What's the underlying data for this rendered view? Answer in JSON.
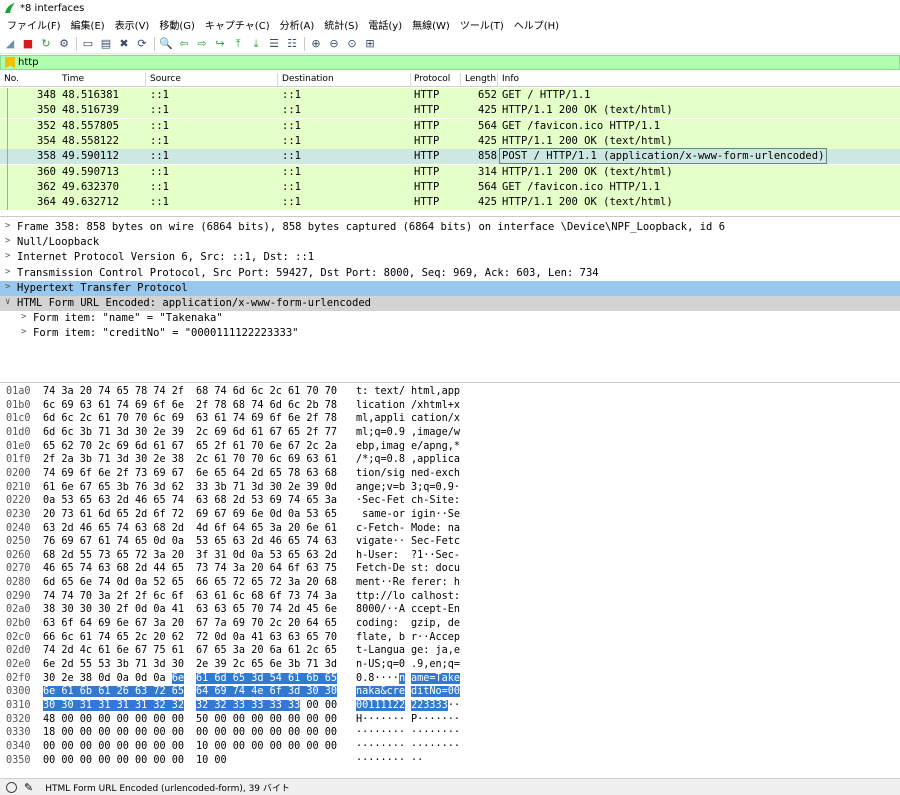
{
  "window": {
    "title": "*8 interfaces"
  },
  "menu": [
    "ファイル(F)",
    "編集(E)",
    "表示(V)",
    "移動(G)",
    "キャプチャ(C)",
    "分析(A)",
    "統計(S)",
    "電話(y)",
    "無線(W)",
    "ツール(T)",
    "ヘルプ(H)"
  ],
  "toolbar": {
    "icons": [
      "shark-fin-icon",
      "stop-icon",
      "restart-icon",
      "options-icon",
      "open-file-icon",
      "save-file-icon",
      "close-file-icon",
      "reload-icon",
      "find-icon",
      "back-icon",
      "forward-icon",
      "goto-icon",
      "first-packet-icon",
      "last-packet-icon",
      "autoscroll-icon",
      "colorize-icon",
      "zoom-in-icon",
      "zoom-out-icon",
      "zoom-reset-icon",
      "resize-columns-icon"
    ],
    "glyphs": [
      "◢",
      "■",
      "↻",
      "⚙",
      "▭",
      "▤",
      "✖",
      "⟳",
      "🔍",
      "⇦",
      "⇨",
      "↪",
      "⤒",
      "⤓",
      "☰",
      "☷",
      "⊕",
      "⊖",
      "⊙",
      "⊞"
    ]
  },
  "filter": {
    "value": "http"
  },
  "packet_list": {
    "columns": {
      "no": "No.",
      "time": "Time",
      "source": "Source",
      "destination": "Destination",
      "protocol": "Protocol",
      "length": "Length",
      "info": "Info"
    },
    "rows": [
      {
        "no": "348",
        "time": "48.516381",
        "source": "::1",
        "destination": "::1",
        "protocol": "HTTP",
        "length": "652",
        "info": "GET / HTTP/1.1"
      },
      {
        "no": "350",
        "time": "48.516739",
        "source": "::1",
        "destination": "::1",
        "protocol": "HTTP",
        "length": "425",
        "info": "HTTP/1.1 200 OK  (text/html)"
      },
      {
        "no": "352",
        "time": "48.557805",
        "source": "::1",
        "destination": "::1",
        "protocol": "HTTP",
        "length": "564",
        "info": "GET /favicon.ico HTTP/1.1"
      },
      {
        "no": "354",
        "time": "48.558122",
        "source": "::1",
        "destination": "::1",
        "protocol": "HTTP",
        "length": "425",
        "info": "HTTP/1.1 200 OK  (text/html)"
      },
      {
        "no": "358",
        "time": "49.590112",
        "source": "::1",
        "destination": "::1",
        "protocol": "HTTP",
        "length": "858",
        "info": "POST / HTTP/1.1  (application/x-www-form-urlencoded)"
      },
      {
        "no": "360",
        "time": "49.590713",
        "source": "::1",
        "destination": "::1",
        "protocol": "HTTP",
        "length": "314",
        "info": "HTTP/1.1 200 OK  (text/html)"
      },
      {
        "no": "362",
        "time": "49.632370",
        "source": "::1",
        "destination": "::1",
        "protocol": "HTTP",
        "length": "564",
        "info": "GET /favicon.ico HTTP/1.1"
      },
      {
        "no": "364",
        "time": "49.632712",
        "source": "::1",
        "destination": "::1",
        "protocol": "HTTP",
        "length": "425",
        "info": "HTTP/1.1 200 OK  (text/html)"
      }
    ],
    "selected_no": "358"
  },
  "details": [
    {
      "text": "Frame 358: 858 bytes on wire (6864 bits), 858 bytes captured (6864 bits) on interface \\Device\\NPF_Loopback, id 6",
      "arrow": ">",
      "level": 0,
      "state": ""
    },
    {
      "text": "Null/Loopback",
      "arrow": ">",
      "level": 0,
      "state": ""
    },
    {
      "text": "Internet Protocol Version 6, Src: ::1, Dst: ::1",
      "arrow": ">",
      "level": 0,
      "state": ""
    },
    {
      "text": "Transmission Control Protocol, Src Port: 59427, Dst Port: 8000, Seq: 969, Ack: 603, Len: 734",
      "arrow": ">",
      "level": 0,
      "state": ""
    },
    {
      "text": "Hypertext Transfer Protocol",
      "arrow": ">",
      "level": 0,
      "state": "highlight"
    },
    {
      "text": "HTML Form URL Encoded: application/x-www-form-urlencoded",
      "arrow": "∨",
      "level": 0,
      "state": "selected"
    },
    {
      "text": "Form item: \"name\" = \"Takenaka\"",
      "arrow": ">",
      "level": 1,
      "state": ""
    },
    {
      "text": "Form item: \"creditNo\" = \"0000111122223333\"",
      "arrow": ">",
      "level": 1,
      "state": ""
    }
  ],
  "hex_dump": [
    {
      "offset": "01a0",
      "hex1": "74 3a 20 74 65 78 74 2f",
      "hex2": "68 74 6d 6c 2c 61 70 70",
      "ascii1": "t: text/",
      "ascii2": "html,app"
    },
    {
      "offset": "01b0",
      "hex1": "6c 69 63 61 74 69 6f 6e",
      "hex2": "2f 78 68 74 6d 6c 2b 78",
      "ascii1": "lication",
      "ascii2": "/xhtml+x"
    },
    {
      "offset": "01c0",
      "hex1": "6d 6c 2c 61 70 70 6c 69",
      "hex2": "63 61 74 69 6f 6e 2f 78",
      "ascii1": "ml,appli",
      "ascii2": "cation/x"
    },
    {
      "offset": "01d0",
      "hex1": "6d 6c 3b 71 3d 30 2e 39",
      "hex2": "2c 69 6d 61 67 65 2f 77",
      "ascii1": "ml;q=0.9",
      "ascii2": ",image/w"
    },
    {
      "offset": "01e0",
      "hex1": "65 62 70 2c 69 6d 61 67",
      "hex2": "65 2f 61 70 6e 67 2c 2a",
      "ascii1": "ebp,imag",
      "ascii2": "e/apng,*"
    },
    {
      "offset": "01f0",
      "hex1": "2f 2a 3b 71 3d 30 2e 38",
      "hex2": "2c 61 70 70 6c 69 63 61",
      "ascii1": "/*;q=0.8",
      "ascii2": ",applica"
    },
    {
      "offset": "0200",
      "hex1": "74 69 6f 6e 2f 73 69 67",
      "hex2": "6e 65 64 2d 65 78 63 68",
      "ascii1": "tion/sig",
      "ascii2": "ned-exch"
    },
    {
      "offset": "0210",
      "hex1": "61 6e 67 65 3b 76 3d 62",
      "hex2": "33 3b 71 3d 30 2e 39 0d",
      "ascii1": "ange;v=b",
      "ascii2": "3;q=0.9·"
    },
    {
      "offset": "0220",
      "hex1": "0a 53 65 63 2d 46 65 74",
      "hex2": "63 68 2d 53 69 74 65 3a",
      "ascii1": "·Sec-Fet",
      "ascii2": "ch-Site:"
    },
    {
      "offset": "0230",
      "hex1": "20 73 61 6d 65 2d 6f 72",
      "hex2": "69 67 69 6e 0d 0a 53 65",
      "ascii1": " same-or",
      "ascii2": "igin··Se"
    },
    {
      "offset": "0240",
      "hex1": "63 2d 46 65 74 63 68 2d",
      "hex2": "4d 6f 64 65 3a 20 6e 61",
      "ascii1": "c-Fetch-",
      "ascii2": "Mode: na"
    },
    {
      "offset": "0250",
      "hex1": "76 69 67 61 74 65 0d 0a",
      "hex2": "53 65 63 2d 46 65 74 63",
      "ascii1": "vigate··",
      "ascii2": "Sec-Fetc"
    },
    {
      "offset": "0260",
      "hex1": "68 2d 55 73 65 72 3a 20",
      "hex2": "3f 31 0d 0a 53 65 63 2d",
      "ascii1": "h-User: ",
      "ascii2": "?1··Sec-"
    },
    {
      "offset": "0270",
      "hex1": "46 65 74 63 68 2d 44 65",
      "hex2": "73 74 3a 20 64 6f 63 75",
      "ascii1": "Fetch-De",
      "ascii2": "st: docu"
    },
    {
      "offset": "0280",
      "hex1": "6d 65 6e 74 0d 0a 52 65",
      "hex2": "66 65 72 65 72 3a 20 68",
      "ascii1": "ment··Re",
      "ascii2": "ferer: h"
    },
    {
      "offset": "0290",
      "hex1": "74 74 70 3a 2f 2f 6c 6f",
      "hex2": "63 61 6c 68 6f 73 74 3a",
      "ascii1": "ttp://lo",
      "ascii2": "calhost:"
    },
    {
      "offset": "02a0",
      "hex1": "38 30 30 30 2f 0d 0a 41",
      "hex2": "63 63 65 70 74 2d 45 6e",
      "ascii1": "8000/··A",
      "ascii2": "ccept-En"
    },
    {
      "offset": "02b0",
      "hex1": "63 6f 64 69 6e 67 3a 20",
      "hex2": "67 7a 69 70 2c 20 64 65",
      "ascii1": "coding: ",
      "ascii2": "gzip, de"
    },
    {
      "offset": "02c0",
      "hex1": "66 6c 61 74 65 2c 20 62",
      "hex2": "72 0d 0a 41 63 63 65 70",
      "ascii1": "flate, b",
      "ascii2": "r··Accep"
    },
    {
      "offset": "02d0",
      "hex1": "74 2d 4c 61 6e 67 75 61",
      "hex2": "67 65 3a 20 6a 61 2c 65",
      "ascii1": "t-Langua",
      "ascii2": "ge: ja,e"
    },
    {
      "offset": "02e0",
      "hex1": "6e 2d 55 53 3b 71 3d 30",
      "hex2": "2e 39 2c 65 6e 3b 71 3d",
      "ascii1": "n-US;q=0",
      "ascii2": ".9,en;q="
    },
    {
      "offset": "02f0",
      "hex1": "30 2e 38 0d 0a 0d 0a ",
      "hex1_hl": "6e",
      "hex2": "",
      "hex2_hl": "61 6d 65 3d 54 61 6b 65",
      "ascii1": "0.8····",
      "ascii1_hl": "n",
      "ascii2": "",
      "ascii2_hl": "ame=Take"
    },
    {
      "offset": "0300",
      "hex1": "",
      "hex1_hl": "6e 61 6b 61 26 63 72 65",
      "hex2": "",
      "hex2_hl": "64 69 74 4e 6f 3d 30 30",
      "ascii1": "",
      "ascii1_hl": "naka&cre",
      "ascii2": "",
      "ascii2_hl": "ditNo=00"
    },
    {
      "offset": "0310",
      "hex1": "",
      "hex1_hl": "30 30 31 31 31 31 32 32",
      "hex2": "",
      "hex2_hl": "32 32 33 33 33 33",
      "hex2_tail": " 00 00",
      "ascii1": "",
      "ascii1_hl": "00111122",
      "ascii2": "",
      "ascii2_hl": "223333",
      "ascii2_tail": "··"
    },
    {
      "offset": "0320",
      "hex1": "48 00 00 00 00 00 00 00",
      "hex2": "50 00 00 00 00 00 00 00",
      "ascii1": "H·······",
      "ascii2": "P·······"
    },
    {
      "offset": "0330",
      "hex1": "18 00 00 00 00 00 00 00",
      "hex2": "00 00 00 00 00 00 00 00",
      "ascii1": "········",
      "ascii2": "········"
    },
    {
      "offset": "0340",
      "hex1": "00 00 00 00 00 00 00 00",
      "hex2": "10 00 00 00 00 00 00 00",
      "ascii1": "········",
      "ascii2": "········"
    },
    {
      "offset": "0350",
      "hex1": "00 00 00 00 00 00 00 00",
      "hex2": "10 00",
      "ascii1": "········",
      "ascii2": "··"
    }
  ],
  "status": {
    "text": "HTML Form URL Encoded (urlencoded-form), 39 バイト"
  }
}
